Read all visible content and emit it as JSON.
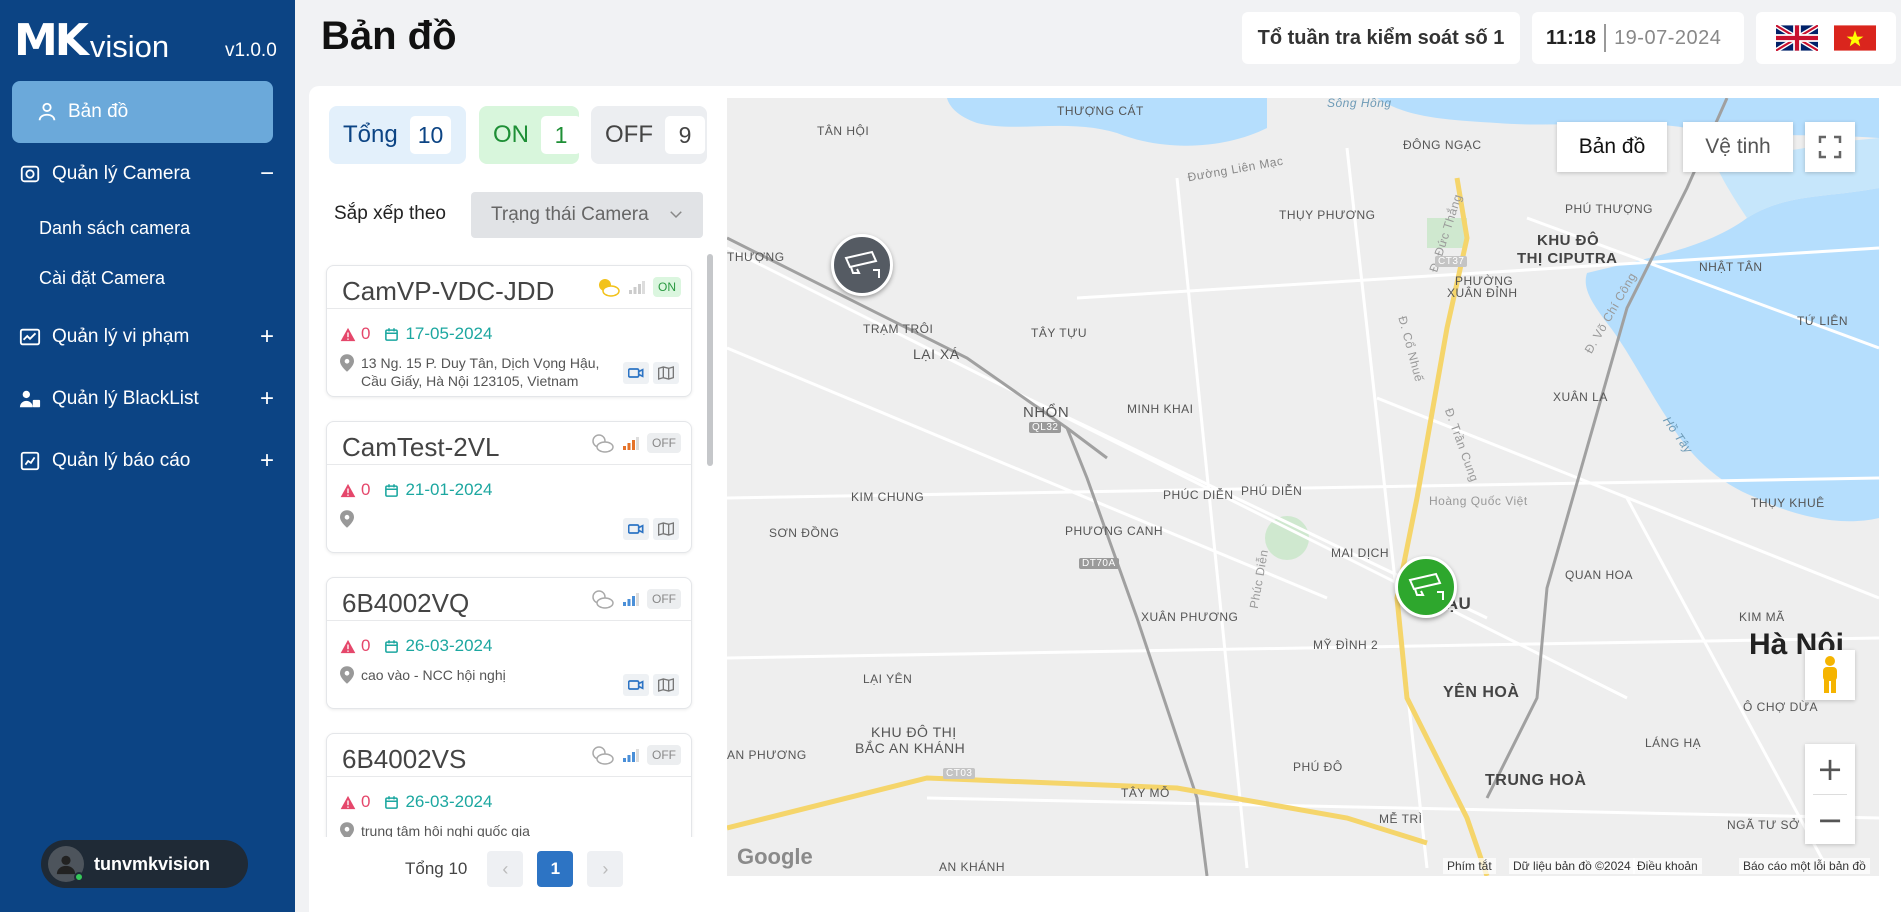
{
  "sidebar": {
    "logo_mk": "MK",
    "logo_vision": "vision",
    "version": "v1.0.0",
    "active_item": "Bản đồ",
    "items": [
      {
        "label": "Quản lý Camera",
        "toggle": "−"
      },
      {
        "label": "Quản lý vi phạm",
        "toggle": "+"
      },
      {
        "label": "Quản lý BlackList",
        "toggle": "+"
      },
      {
        "label": "Quản lý báo cáo",
        "toggle": "+"
      }
    ],
    "sub_items": [
      "Danh sách camera",
      "Cài đặt Camera"
    ],
    "user": "tunvmkvision"
  },
  "header": {
    "title": "Bản đồ",
    "unit": "Tổ tuần tra kiểm soát số 1",
    "time": "11:18",
    "date": "19-07-2024"
  },
  "stats": {
    "total_label": "Tổng",
    "total": "10",
    "on_label": "ON",
    "on": "1",
    "off_label": "OFF",
    "off": "9"
  },
  "sort": {
    "label": "Sắp xếp theo",
    "value": "Trạng thái Camera"
  },
  "cameras": [
    {
      "name": "CamVP-VDC-JDD",
      "status": "ON",
      "violations": "0",
      "date": "17-05-2024",
      "address": "13 Ng. 15 P. Duy Tân, Dịch Vọng Hậu, Cầu Giấy, Hà Nội 123105, Vietnam"
    },
    {
      "name": "CamTest-2VL",
      "status": "OFF",
      "violations": "0",
      "date": "21-01-2024",
      "address": ""
    },
    {
      "name": "6B4002VQ",
      "status": "OFF",
      "violations": "0",
      "date": "26-03-2024",
      "address": "cao vào - NCC hội nghị"
    },
    {
      "name": "6B4002VS",
      "status": "OFF",
      "violations": "0",
      "date": "26-03-2024",
      "address": "trung tâm hội nghị quốc gia"
    }
  ],
  "pagination": {
    "total_label": "Tổng 10",
    "current": "1"
  },
  "map": {
    "type_map": "Bản đồ",
    "type_satellite": "Vệ tinh",
    "google": "Google",
    "attrib_shortcuts": "Phím tắt",
    "attrib_data": "Dữ liệu bản đồ ©2024",
    "attrib_terms": "Điều khoản",
    "attrib_report": "Báo cáo một lỗi bản đồ",
    "labels": {
      "thuong_cat": "THƯỢNG CÁT",
      "song_hong": "Sông Hồng",
      "tan_hoi": "TÂN HỘI",
      "dong_ngac": "ĐÔNG NGẠC",
      "duong_lien_mac": "Đường Liên Mạc",
      "thuy_phuong": "THỤY PHƯƠNG",
      "khu_do_thi_ciputra_1": "KHU ĐÔ",
      "khu_do_thi_ciputra_2": "THỊ CIPUTRA",
      "phu_thuong": "PHÚ THƯỢNG",
      "nhat_tan": "NHẬT TÂN",
      "truong": "THƯỢNG",
      "xuan_dinh_1": "PHƯỜNG",
      "xuan_dinh_2": "XUÂN ĐỈNH",
      "tram_troi": "TRẠM TRÔI",
      "tay_tuu": "TÂY TỰU",
      "lai_xa": "LẠI XÁ",
      "tu_lien": "TỨ LIÊN",
      "xuan_la": "XUÂN LA",
      "nhon": "NHỔN",
      "minh_khai": "MINH KHAI",
      "ho_tay": "Hồ Tây",
      "phuc_dien": "PHÚC DIỄN",
      "phu_dien": "PHÚ DIỄN",
      "hoang_quoc_viet": "Hoàng Quốc Việt",
      "kim_chung": "KIM CHUNG",
      "thuy_khue": "THỤY KHUÊ",
      "son_dong": "SƠN ĐỒNG",
      "phuong_canh": "PHƯƠNG CANH",
      "mai_dich": "MAI DỊCH",
      "quan_hoa": "QUAN HOA",
      "dich_vong_hau": "HẬU",
      "xuan_phuong": "XUÂN PHƯƠNG",
      "my_dinh_2": "MỸ ĐÌNH 2",
      "kim_ma": "KIM MÃ",
      "ha_noi": "Hà Nội",
      "lai_yen": "LẠI YÊN",
      "yen_hoa": "YÊN HOÀ",
      "o_cho_dua": "Ô CHỢ DỪA",
      "khu_do_thi_bac_an_khanh_1": "KHU ĐÔ THỊ",
      "khu_do_thi_bac_an_khanh_2": "BẮC AN KHÁNH",
      "lang_ha": "LÁNG HẠ",
      "an_phuong": "AN PHƯƠNG",
      "phu_do": "PHÚ ĐÔ",
      "trung_hoa": "TRUNG HOÀ",
      "tay_mo": "TÂY MỖ",
      "me_tri": "MỄ TRÌ",
      "nga_tu_so": "NGÃ TƯ SỞ",
      "an_khanh": "AN KHÁNH",
      "duc_thang": "Đ. Đức Thắng",
      "co_nhue": "Đ. Cổ Nhuế",
      "tran_cung": "Đ. Trần Cung",
      "vo_chi_cong": "Đ. Võ Chí Công",
      "phuc_dien_road": "Phúc Diễn",
      "ql32": "QL32",
      "ct37": "CT37",
      "dt70a": "DT70A",
      "ct03": "CT03"
    }
  },
  "colors": {
    "sidebar": "#0c4484",
    "active": "#6ba9da",
    "on": "#2ea72d",
    "off": "#555b63",
    "violation": "#e5476b",
    "date": "#1ca7a0"
  }
}
